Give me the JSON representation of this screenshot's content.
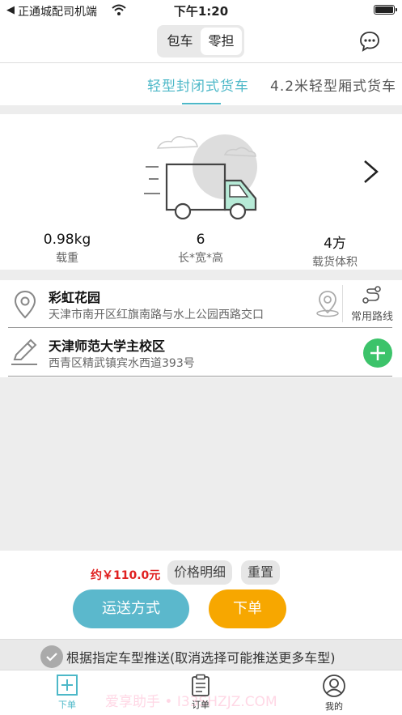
{
  "status_bar": {
    "back_label": "◀",
    "carrier": "正通城配司机端",
    "time": "下午1:20"
  },
  "header": {
    "segments": [
      {
        "label": "包车",
        "active": false
      },
      {
        "label": "零担",
        "active": true
      }
    ]
  },
  "vehicle_tabs": [
    {
      "label": "轻型封闭式货车",
      "active": true
    },
    {
      "label": "4.2米轻型厢式货车",
      "active": false
    }
  ],
  "vehicle_specs": [
    {
      "value": "0.98kg",
      "label": "载重"
    },
    {
      "value": "6",
      "label": "长*宽*高"
    },
    {
      "value": "4方",
      "label": "载货体积"
    }
  ],
  "origin": {
    "name": "彩虹花园",
    "address": "天津市南开区红旗南路与水上公园西路交口",
    "routes_label": "常用路线"
  },
  "destination": {
    "name": "天津师范大学主校区",
    "address": "西青区精武镇宾水西道393号"
  },
  "pricing": {
    "price": "约￥110.0元",
    "detail_label": "价格明细",
    "reset_label": "重置",
    "delivery_label": "运送方式",
    "order_label": "下单"
  },
  "push_option": {
    "label": "根据指定车型推送(取消选择可能推送更多车型)"
  },
  "tabbar": [
    {
      "label": "下单",
      "active": true
    },
    {
      "label": "订单",
      "active": false
    },
    {
      "label": "我的",
      "active": false
    }
  ],
  "watermark": "爱享助手 • I33SHZJZ.COM",
  "colors": {
    "accent": "#4db8c8",
    "order_button": "#f7a700",
    "delivery_button": "#5bb8cc",
    "add_button": "#3cc36a",
    "price": "#e02020"
  }
}
